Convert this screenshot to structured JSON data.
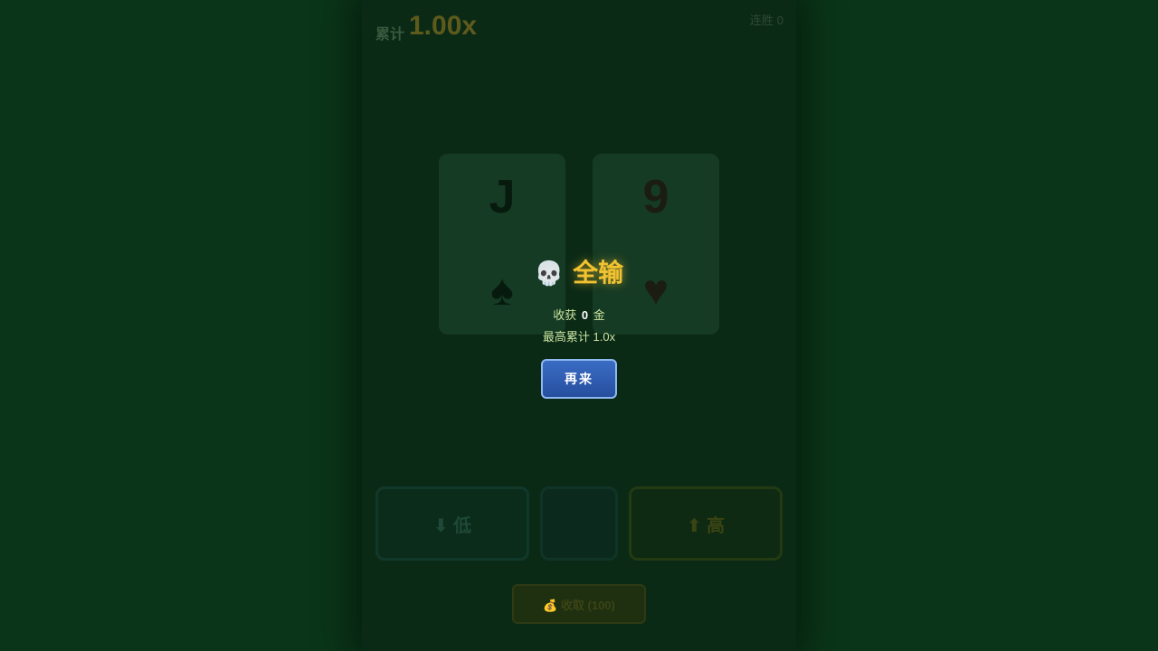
{
  "hud": {
    "multiplier_label": "累计",
    "multiplier_value": "1.00x",
    "streak_label": "连胜",
    "streak_value": "0"
  },
  "cards": [
    {
      "rank": "J",
      "suit": "♠"
    },
    {
      "rank": "9",
      "suit": "♥"
    }
  ],
  "controls": {
    "lower_label": "⬇ 低",
    "higher_label": "⬆ 高",
    "cashout_label": "💰 收取 (100)"
  },
  "result": {
    "icon": "💀",
    "title": "全输",
    "gain_prefix": "收获",
    "gain_value": "0",
    "gain_unit": "金",
    "best_label": "最高累计",
    "best_value": "1.0x",
    "retry_label": "再来"
  },
  "colors": {
    "title_gold": "#f2c230",
    "retry_blue": "#2f5db3",
    "felt_green": "#0a3518"
  }
}
